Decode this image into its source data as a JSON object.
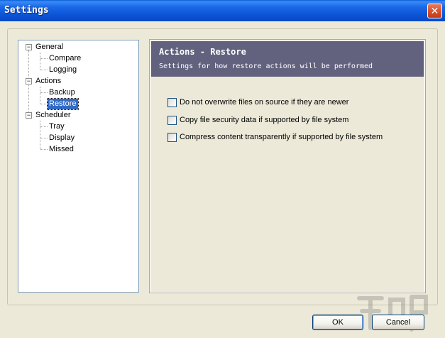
{
  "window": {
    "title": "Settings",
    "close_glyph": "✕"
  },
  "tree": {
    "items": [
      {
        "label": "General",
        "expander": "−"
      },
      {
        "label": "Compare"
      },
      {
        "label": "Logging"
      },
      {
        "label": "Actions",
        "expander": "−"
      },
      {
        "label": "Backup"
      },
      {
        "label": "Restore",
        "selected": true
      },
      {
        "label": "Scheduler",
        "expander": "−"
      },
      {
        "label": "Tray"
      },
      {
        "label": "Display"
      },
      {
        "label": "Missed"
      }
    ]
  },
  "panel": {
    "title": "Actions - Restore",
    "subtitle": "Settings for how restore actions will be performed",
    "header_color": "#62627f",
    "options": [
      {
        "label": "Do not overwrite files on source if they are newer",
        "checked": false
      },
      {
        "label": "Copy file security data if supported by file system",
        "checked": false
      },
      {
        "label": "Compress content transparently if supported by file system",
        "checked": false
      }
    ]
  },
  "buttons": {
    "ok": "OK",
    "cancel": "Cancel"
  },
  "watermark": {
    "icon": "watermark-logo-icon"
  }
}
